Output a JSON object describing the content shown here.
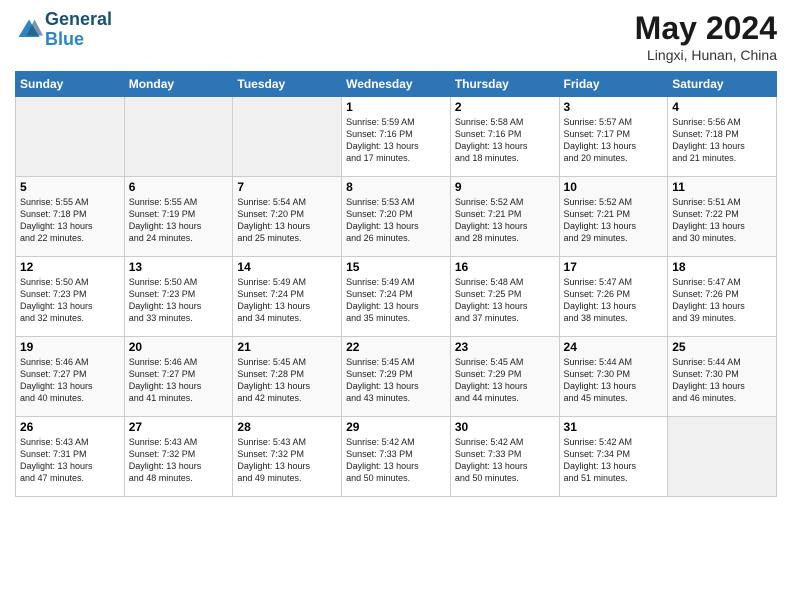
{
  "header": {
    "logo_line1": "General",
    "logo_line2": "Blue",
    "month": "May 2024",
    "location": "Lingxi, Hunan, China"
  },
  "weekdays": [
    "Sunday",
    "Monday",
    "Tuesday",
    "Wednesday",
    "Thursday",
    "Friday",
    "Saturday"
  ],
  "weeks": [
    [
      {
        "day": "",
        "info": ""
      },
      {
        "day": "",
        "info": ""
      },
      {
        "day": "",
        "info": ""
      },
      {
        "day": "1",
        "info": "Sunrise: 5:59 AM\nSunset: 7:16 PM\nDaylight: 13 hours\nand 17 minutes."
      },
      {
        "day": "2",
        "info": "Sunrise: 5:58 AM\nSunset: 7:16 PM\nDaylight: 13 hours\nand 18 minutes."
      },
      {
        "day": "3",
        "info": "Sunrise: 5:57 AM\nSunset: 7:17 PM\nDaylight: 13 hours\nand 20 minutes."
      },
      {
        "day": "4",
        "info": "Sunrise: 5:56 AM\nSunset: 7:18 PM\nDaylight: 13 hours\nand 21 minutes."
      }
    ],
    [
      {
        "day": "5",
        "info": "Sunrise: 5:55 AM\nSunset: 7:18 PM\nDaylight: 13 hours\nand 22 minutes."
      },
      {
        "day": "6",
        "info": "Sunrise: 5:55 AM\nSunset: 7:19 PM\nDaylight: 13 hours\nand 24 minutes."
      },
      {
        "day": "7",
        "info": "Sunrise: 5:54 AM\nSunset: 7:20 PM\nDaylight: 13 hours\nand 25 minutes."
      },
      {
        "day": "8",
        "info": "Sunrise: 5:53 AM\nSunset: 7:20 PM\nDaylight: 13 hours\nand 26 minutes."
      },
      {
        "day": "9",
        "info": "Sunrise: 5:52 AM\nSunset: 7:21 PM\nDaylight: 13 hours\nand 28 minutes."
      },
      {
        "day": "10",
        "info": "Sunrise: 5:52 AM\nSunset: 7:21 PM\nDaylight: 13 hours\nand 29 minutes."
      },
      {
        "day": "11",
        "info": "Sunrise: 5:51 AM\nSunset: 7:22 PM\nDaylight: 13 hours\nand 30 minutes."
      }
    ],
    [
      {
        "day": "12",
        "info": "Sunrise: 5:50 AM\nSunset: 7:23 PM\nDaylight: 13 hours\nand 32 minutes."
      },
      {
        "day": "13",
        "info": "Sunrise: 5:50 AM\nSunset: 7:23 PM\nDaylight: 13 hours\nand 33 minutes."
      },
      {
        "day": "14",
        "info": "Sunrise: 5:49 AM\nSunset: 7:24 PM\nDaylight: 13 hours\nand 34 minutes."
      },
      {
        "day": "15",
        "info": "Sunrise: 5:49 AM\nSunset: 7:24 PM\nDaylight: 13 hours\nand 35 minutes."
      },
      {
        "day": "16",
        "info": "Sunrise: 5:48 AM\nSunset: 7:25 PM\nDaylight: 13 hours\nand 37 minutes."
      },
      {
        "day": "17",
        "info": "Sunrise: 5:47 AM\nSunset: 7:26 PM\nDaylight: 13 hours\nand 38 minutes."
      },
      {
        "day": "18",
        "info": "Sunrise: 5:47 AM\nSunset: 7:26 PM\nDaylight: 13 hours\nand 39 minutes."
      }
    ],
    [
      {
        "day": "19",
        "info": "Sunrise: 5:46 AM\nSunset: 7:27 PM\nDaylight: 13 hours\nand 40 minutes."
      },
      {
        "day": "20",
        "info": "Sunrise: 5:46 AM\nSunset: 7:27 PM\nDaylight: 13 hours\nand 41 minutes."
      },
      {
        "day": "21",
        "info": "Sunrise: 5:45 AM\nSunset: 7:28 PM\nDaylight: 13 hours\nand 42 minutes."
      },
      {
        "day": "22",
        "info": "Sunrise: 5:45 AM\nSunset: 7:29 PM\nDaylight: 13 hours\nand 43 minutes."
      },
      {
        "day": "23",
        "info": "Sunrise: 5:45 AM\nSunset: 7:29 PM\nDaylight: 13 hours\nand 44 minutes."
      },
      {
        "day": "24",
        "info": "Sunrise: 5:44 AM\nSunset: 7:30 PM\nDaylight: 13 hours\nand 45 minutes."
      },
      {
        "day": "25",
        "info": "Sunrise: 5:44 AM\nSunset: 7:30 PM\nDaylight: 13 hours\nand 46 minutes."
      }
    ],
    [
      {
        "day": "26",
        "info": "Sunrise: 5:43 AM\nSunset: 7:31 PM\nDaylight: 13 hours\nand 47 minutes."
      },
      {
        "day": "27",
        "info": "Sunrise: 5:43 AM\nSunset: 7:32 PM\nDaylight: 13 hours\nand 48 minutes."
      },
      {
        "day": "28",
        "info": "Sunrise: 5:43 AM\nSunset: 7:32 PM\nDaylight: 13 hours\nand 49 minutes."
      },
      {
        "day": "29",
        "info": "Sunrise: 5:42 AM\nSunset: 7:33 PM\nDaylight: 13 hours\nand 50 minutes."
      },
      {
        "day": "30",
        "info": "Sunrise: 5:42 AM\nSunset: 7:33 PM\nDaylight: 13 hours\nand 50 minutes."
      },
      {
        "day": "31",
        "info": "Sunrise: 5:42 AM\nSunset: 7:34 PM\nDaylight: 13 hours\nand 51 minutes."
      },
      {
        "day": "",
        "info": ""
      }
    ]
  ]
}
